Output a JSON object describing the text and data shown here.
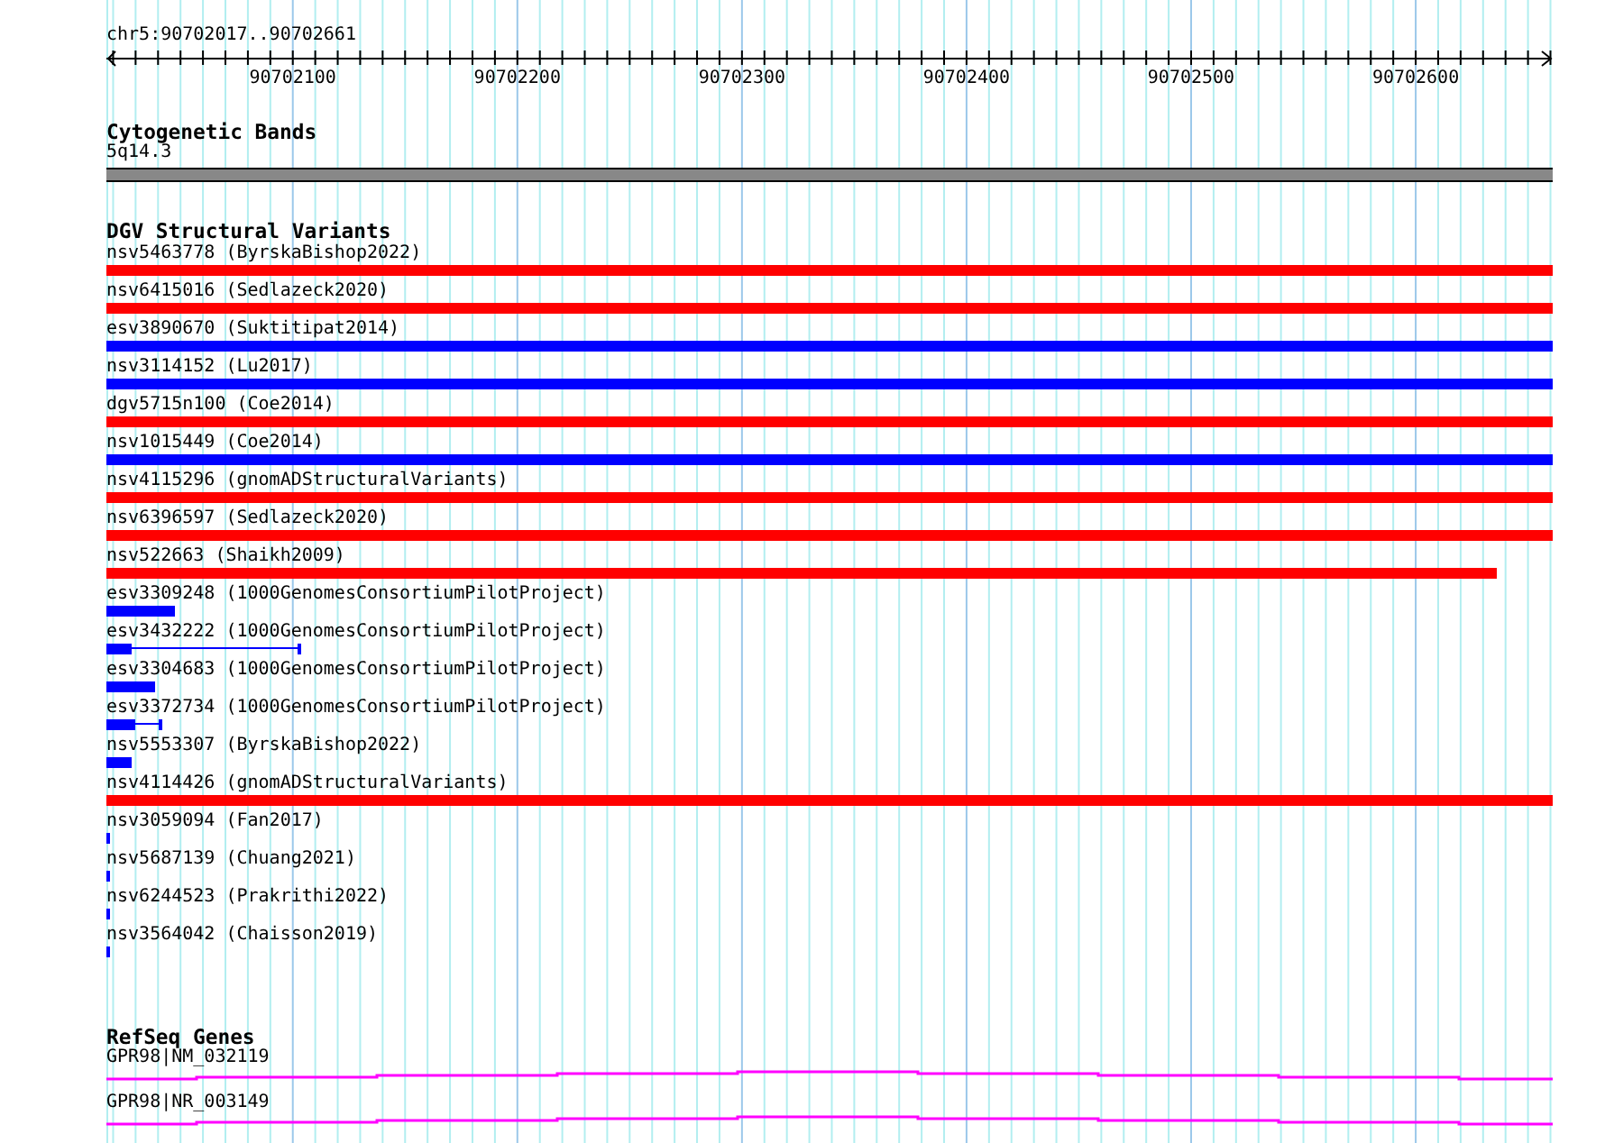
{
  "ruler": {
    "position": "chr5:90702017..90702661",
    "tick_labels": [
      "90702100",
      "90702200",
      "90702300",
      "90702400",
      "90702500",
      "90702600"
    ]
  },
  "cytogenetic_bands": {
    "title": "Cytogenetic Bands",
    "bands": [
      {
        "label": "5q14.3"
      }
    ]
  },
  "dgv_structural_variants": {
    "title": "DGV Structural Variants",
    "rows": [
      {
        "label": "nsv5463778 (ByrskaBishop2022)",
        "color": "#ff0000",
        "kind": "solid",
        "level": 1
      },
      {
        "label": "nsv6415016 (Sedlazeck2020)",
        "color": "#ff0000",
        "kind": "solid",
        "level": 1
      },
      {
        "label": "esv3890670 (Suktitipat2014)",
        "color": "#0000ff",
        "kind": "solid",
        "level": 1
      },
      {
        "label": "nsv3114152 (Lu2017)",
        "color": "#0000ff",
        "kind": "solid",
        "level": 1
      },
      {
        "label": "dgv5715n100 (Coe2014)",
        "color": "#ff0000",
        "kind": "solid",
        "level": 1
      },
      {
        "label": "nsv1015449 (Coe2014)",
        "color": "#0000ff",
        "kind": "solid",
        "level": 1
      },
      {
        "label": "nsv4115296 (gnomADStructuralVariants)",
        "color": "#ff0000",
        "kind": "solid",
        "level": 1
      },
      {
        "label": "nsv6396597 (Sedlazeck2020)",
        "color": "#ff0000",
        "kind": "solid",
        "level": 1
      },
      {
        "label": "nsv522663 (Shaikh2009)",
        "color": "#ff0000",
        "kind": "solid",
        "level": 0.961
      },
      {
        "label": "esv3309248 (1000GenomesConsortiumPilotProject)",
        "color": "#0000ff",
        "kind": "solid",
        "level": 0.047
      },
      {
        "label": "esv3432222 (1000GenomesConsortiumPilotProject)",
        "color": "#0000ff",
        "kind": "linked",
        "level": 0.135,
        "block": {
          "level": 0.017
        }
      },
      {
        "label": "esv3304683 (1000GenomesConsortiumPilotProject)",
        "color": "#0000ff",
        "kind": "solid",
        "level": 0.034
      },
      {
        "label": "esv3372734 (1000GenomesConsortiumPilotProject)",
        "color": "#0000ff",
        "kind": "linked",
        "level": 0.039,
        "block": {
          "level": 0.02
        }
      },
      {
        "label": "nsv5553307 (ByrskaBishop2022)",
        "color": "#0000ff",
        "kind": "solid",
        "level": 0.017
      },
      {
        "label": "nsv4114426 (gnomADStructuralVariants)",
        "color": "#ff0000",
        "kind": "solid",
        "level": 1
      },
      {
        "label": "nsv3059094 (Fan2017)",
        "color": "#0000ff",
        "kind": "solid",
        "level": 0.003
      },
      {
        "label": "nsv5687139 (Chuang2021)",
        "color": "#0000ff",
        "kind": "solid",
        "level": 0.003
      },
      {
        "label": "nsv6244523 (Prakrithi2022)",
        "color": "#0000ff",
        "kind": "solid",
        "level": 0.003
      },
      {
        "label": "nsv3564042 (Chaisson2019)",
        "color": "#0000ff",
        "kind": "solid",
        "level": 0.003
      }
    ]
  },
  "refseq_genes": {
    "title": "RefSeq Genes",
    "genes": [
      {
        "label": "GPR98|NM_032119"
      },
      {
        "label": "GPR98|NR_003149"
      }
    ]
  }
}
